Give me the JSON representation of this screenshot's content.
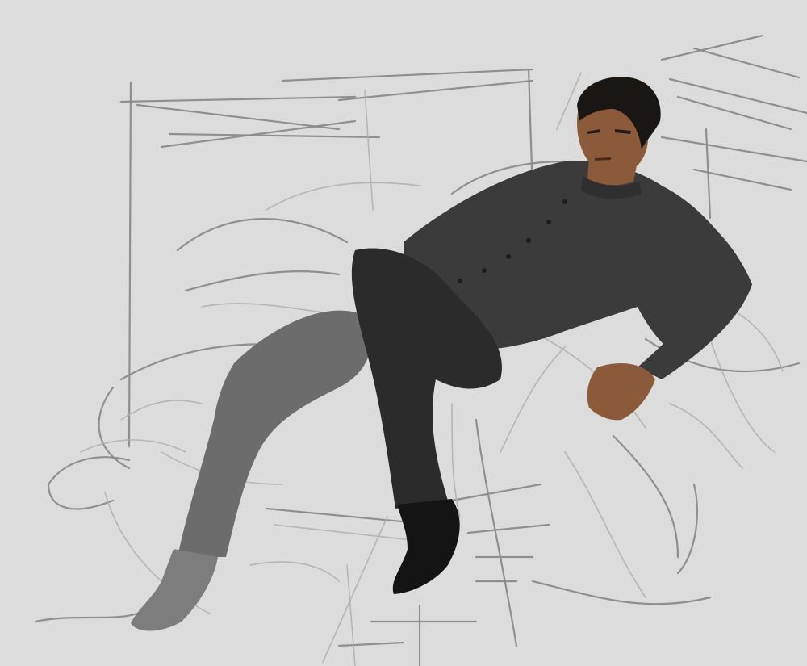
{
  "artwork": {
    "subject": "",
    "palette": {
      "background": "#dcdcdc",
      "sketch_lines": "#8a8a8a",
      "shirt": "#3b3b3b",
      "pants_dark": "#2b2b2b",
      "pants_light": "#6c6c6c",
      "skin": "#8a5a3b",
      "hair": "#1a1614"
    }
  }
}
